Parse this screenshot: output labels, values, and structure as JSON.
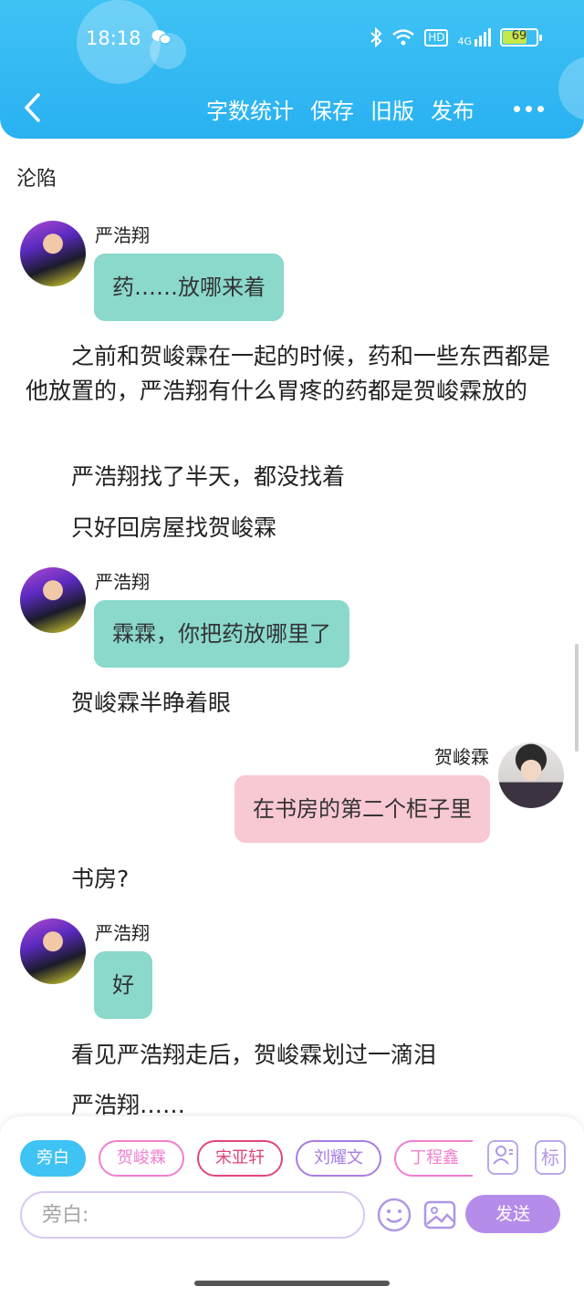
{
  "status_bar": {
    "time": "18:18",
    "network": "4G",
    "hd": "HD",
    "battery": "69"
  },
  "toolbar": {
    "word_count": "字数统计",
    "save": "保存",
    "old_version": "旧版",
    "publish": "发布"
  },
  "story": {
    "title": "沦陷",
    "messages": [
      {
        "type": "dialog",
        "speaker": "严浩翔",
        "text": "药……放哪来着",
        "side": "left"
      },
      {
        "type": "narration",
        "text": "之前和贺峻霖在一起的时候，药和一些东西都是他放置的，严浩翔有什么胃疼的药都是贺峻霖放的"
      },
      {
        "type": "narration",
        "text": "严浩翔找了半天，都没找着"
      },
      {
        "type": "narration",
        "text": "只好回房屋找贺峻霖"
      },
      {
        "type": "dialog",
        "speaker": "严浩翔",
        "text": "霖霖，你把药放哪里了",
        "side": "left"
      },
      {
        "type": "narration",
        "text": "贺峻霖半睁着眼"
      },
      {
        "type": "dialog",
        "speaker": "贺峻霖",
        "text": "在书房的第二个柜子里",
        "side": "right"
      },
      {
        "type": "narration",
        "text": "书房?"
      },
      {
        "type": "dialog",
        "speaker": "严浩翔",
        "text": "好",
        "side": "left"
      },
      {
        "type": "narration",
        "text": "看见严浩翔走后，贺峻霖划过一滴泪"
      },
      {
        "type": "narration",
        "text": "严浩翔……"
      }
    ]
  },
  "composer": {
    "roles": [
      "旁白",
      "贺峻霖",
      "宋亚轩",
      "刘耀文",
      "丁程鑫"
    ],
    "role_colors": [
      "#3fc2f4",
      "#f07fd0",
      "#e0457e",
      "#a77de0",
      "#f07fd0"
    ],
    "tag_label": "标",
    "placeholder": "旁白:",
    "send": "发送"
  }
}
